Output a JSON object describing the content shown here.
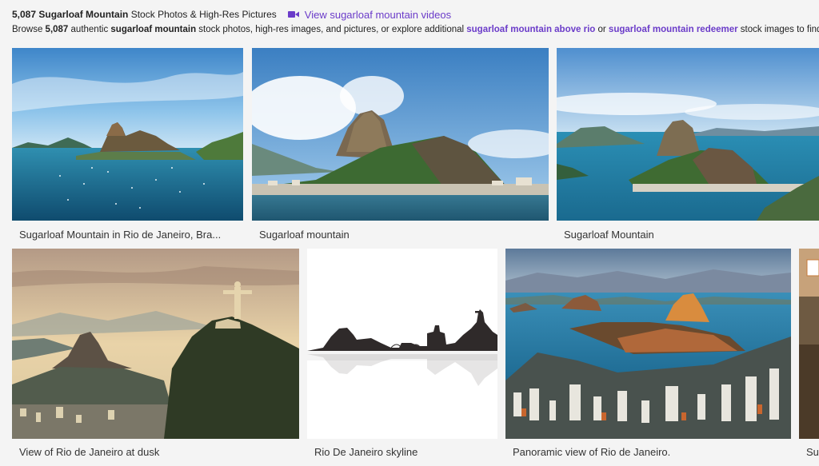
{
  "header": {
    "count": "5,087",
    "title_bold": "Sugarloaf Mountain",
    "title_rest": "Stock Photos & High-Res Pictures",
    "video_link": "View sugarloaf mountain videos"
  },
  "description": {
    "t1": "Browse ",
    "count": "5,087",
    "t2": " authentic ",
    "term": "sugarloaf mountain",
    "t3": " stock photos, high-res images, and pictures, or explore additional ",
    "link1": "sugarloaf mountain above rio",
    "t4": " or ",
    "link2": "sugarloaf mountain redeemer",
    "t5": " stock images to find the right photo at the right size and resolution for your project."
  },
  "results": [
    {
      "caption": "Sugarloaf Mountain in Rio de Janeiro, Bra...",
      "icon": "photo-thumbnail"
    },
    {
      "caption": "Sugarloaf mountain",
      "icon": "photo-thumbnail"
    },
    {
      "caption": "Sugarloaf Mountain",
      "icon": "photo-thumbnail"
    },
    {
      "caption": "View of Rio de Janeiro at dusk",
      "icon": "photo-thumbnail"
    },
    {
      "caption": "Rio De Janeiro skyline",
      "icon": "illustration-thumbnail"
    },
    {
      "caption": "Panoramic view of Rio de Janeiro.",
      "icon": "photo-thumbnail"
    },
    {
      "caption": "Su",
      "icon": "photo-thumbnail"
    }
  ],
  "colors": {
    "accent": "#6b3cc9",
    "background": "#f4f4f4",
    "text": "#222222"
  }
}
